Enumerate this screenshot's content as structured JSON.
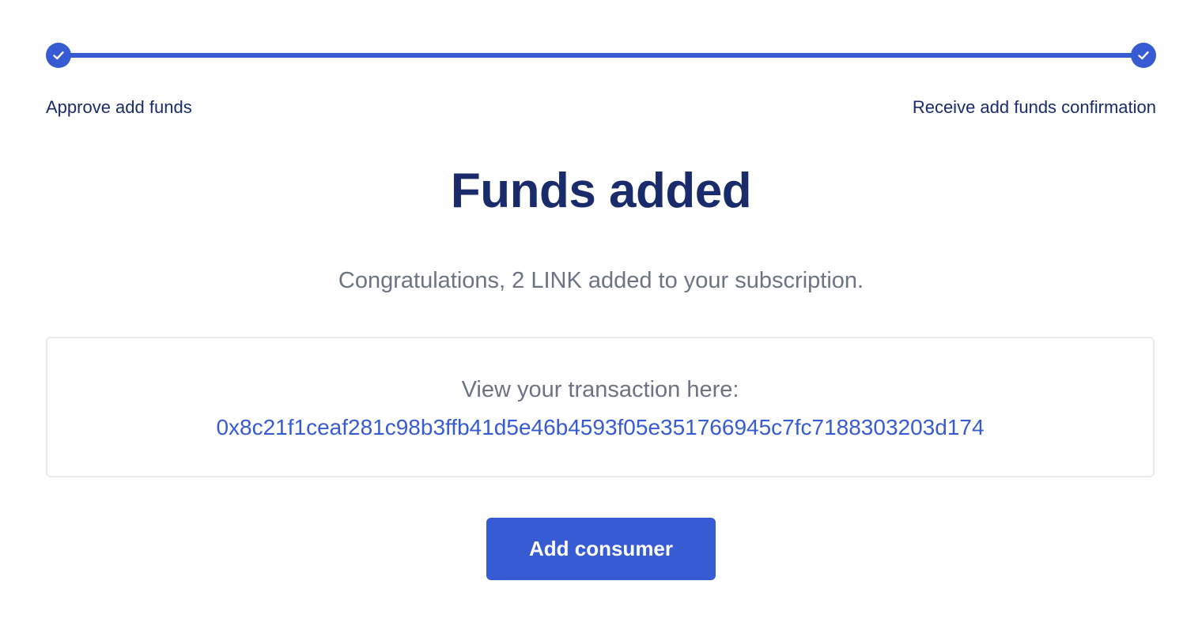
{
  "stepper": {
    "steps": [
      {
        "label": "Approve add funds",
        "status": "complete",
        "icon": "check-icon"
      },
      {
        "label": "Receive add funds confirmation",
        "status": "complete",
        "icon": "check-icon"
      }
    ]
  },
  "main": {
    "title": "Funds added",
    "message": "Congratulations, 2 LINK added to your subscription.",
    "transaction": {
      "caption": "View your transaction here:",
      "hash": "0x8c21f1ceaf281c98b3ffb41d5e46b4593f05e351766945c7fc7188303203d174"
    },
    "primary_button_label": "Add consumer"
  },
  "colors": {
    "accent": "#375bd2",
    "heading": "#1a2b6b",
    "muted_text": "#6c7385",
    "border": "#e8eaee"
  }
}
